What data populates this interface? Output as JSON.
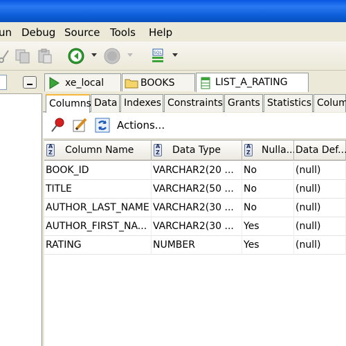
{
  "menu": {
    "items": [
      "un",
      "Debug",
      "Source",
      "Tools",
      "Help"
    ]
  },
  "toolbar": {
    "icons": [
      "cut-icon",
      "copy-icon",
      "paste-icon",
      "back-icon",
      "forward-icon",
      "sql-icon"
    ]
  },
  "tabs": {
    "documents": [
      {
        "label": "xe_local",
        "icon": "connection-icon"
      },
      {
        "label": "BOOKS",
        "icon": "folder-icon"
      },
      {
        "label": "LIST_A_RATING",
        "icon": "table-icon"
      }
    ],
    "sub": [
      "Columns",
      "Data",
      "Indexes",
      "Constraints",
      "Grants",
      "Statistics",
      "Colum"
    ]
  },
  "actions": {
    "label": "Actions..."
  },
  "grid": {
    "headers": [
      "Column Name",
      "Data Type",
      "Nulla...",
      "Data Def..."
    ],
    "rows": [
      [
        "BOOK_ID",
        "VARCHAR2(20 ...",
        "No",
        "(null)"
      ],
      [
        "TITLE",
        "VARCHAR2(50 ...",
        "No",
        "(null)"
      ],
      [
        "AUTHOR_LAST_NAME",
        "VARCHAR2(30 ...",
        "No",
        "(null)"
      ],
      [
        "AUTHOR_FIRST_NA...",
        "VARCHAR2(30 ...",
        "Yes",
        "(null)"
      ],
      [
        "RATING",
        "NUMBER",
        "Yes",
        "(null)"
      ]
    ]
  },
  "colors": {
    "titlebar": "#0a58e0",
    "accent_tab": "#f7b53b",
    "background": "#ece9d8"
  }
}
